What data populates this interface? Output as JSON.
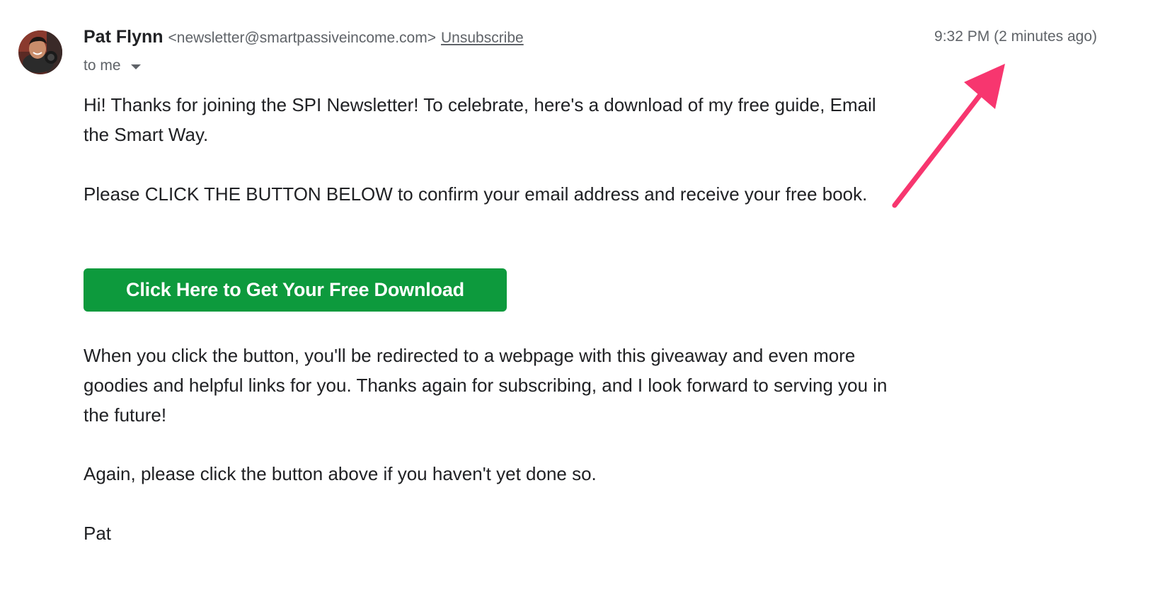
{
  "email": {
    "sender_name": "Pat Flynn",
    "sender_email": "<newsletter@smartpassiveincome.com>",
    "unsubscribe_label": "Unsubscribe",
    "recipient_label": "to me",
    "timestamp": "9:32 PM (2 minutes ago)",
    "body": {
      "paragraph_1": "Hi! Thanks for joining the SPI Newsletter! To celebrate, here's a download of my free guide, Email the Smart Way.",
      "paragraph_2": "Please CLICK THE BUTTON BELOW to confirm your email address and receive your free book.",
      "button_label": "Click Here to Get Your Free Download",
      "paragraph_3": "When you click the button, you'll be redirected to a webpage with this giveaway and even more goodies and helpful links for you. Thanks again for subscribing, and I look forward to serving you in the future!",
      "paragraph_4": "Again, please click the button above if you haven't yet done so.",
      "signature": "Pat"
    }
  },
  "colors": {
    "button": "#0d9a3d",
    "annotation_arrow": "#f7366f",
    "secondary_text": "#5f6368"
  },
  "icons": {
    "avatar": "sender-avatar",
    "recipient_dropdown": "caret-down-icon",
    "annotation": "arrow-annotation"
  }
}
